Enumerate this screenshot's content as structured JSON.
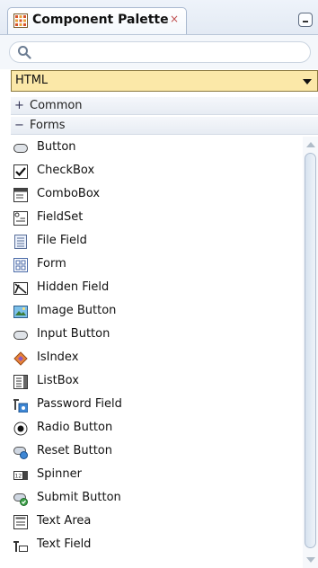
{
  "panel": {
    "title": "Component Palette",
    "close_glyph": "×"
  },
  "search": {
    "placeholder": "",
    "value": ""
  },
  "library_select": {
    "selected": "HTML"
  },
  "categories": [
    {
      "toggle": "+",
      "label": "Common",
      "expanded": false
    },
    {
      "toggle": "−",
      "label": "Forms",
      "expanded": true
    }
  ],
  "items": [
    {
      "label": "Button",
      "icon": "button-icon"
    },
    {
      "label": "CheckBox",
      "icon": "checkbox-icon"
    },
    {
      "label": "ComboBox",
      "icon": "combobox-icon"
    },
    {
      "label": "FieldSet",
      "icon": "fieldset-icon"
    },
    {
      "label": "File Field",
      "icon": "file-field-icon"
    },
    {
      "label": "Form",
      "icon": "form-icon"
    },
    {
      "label": "Hidden Field",
      "icon": "hidden-field-icon"
    },
    {
      "label": "Image Button",
      "icon": "image-button-icon"
    },
    {
      "label": "Input Button",
      "icon": "input-button-icon"
    },
    {
      "label": "IsIndex",
      "icon": "isindex-icon"
    },
    {
      "label": "ListBox",
      "icon": "listbox-icon"
    },
    {
      "label": "Password Field",
      "icon": "password-field-icon"
    },
    {
      "label": "Radio Button",
      "icon": "radio-button-icon"
    },
    {
      "label": "Reset Button",
      "icon": "reset-button-icon"
    },
    {
      "label": "Spinner",
      "icon": "spinner-icon"
    },
    {
      "label": "Submit Button",
      "icon": "submit-button-icon"
    },
    {
      "label": "Text Area",
      "icon": "text-area-icon"
    },
    {
      "label": "Text Field",
      "icon": "text-field-icon"
    }
  ],
  "colors": {
    "select_bg": "#fbe8a8",
    "accent": "#2f6db5"
  }
}
